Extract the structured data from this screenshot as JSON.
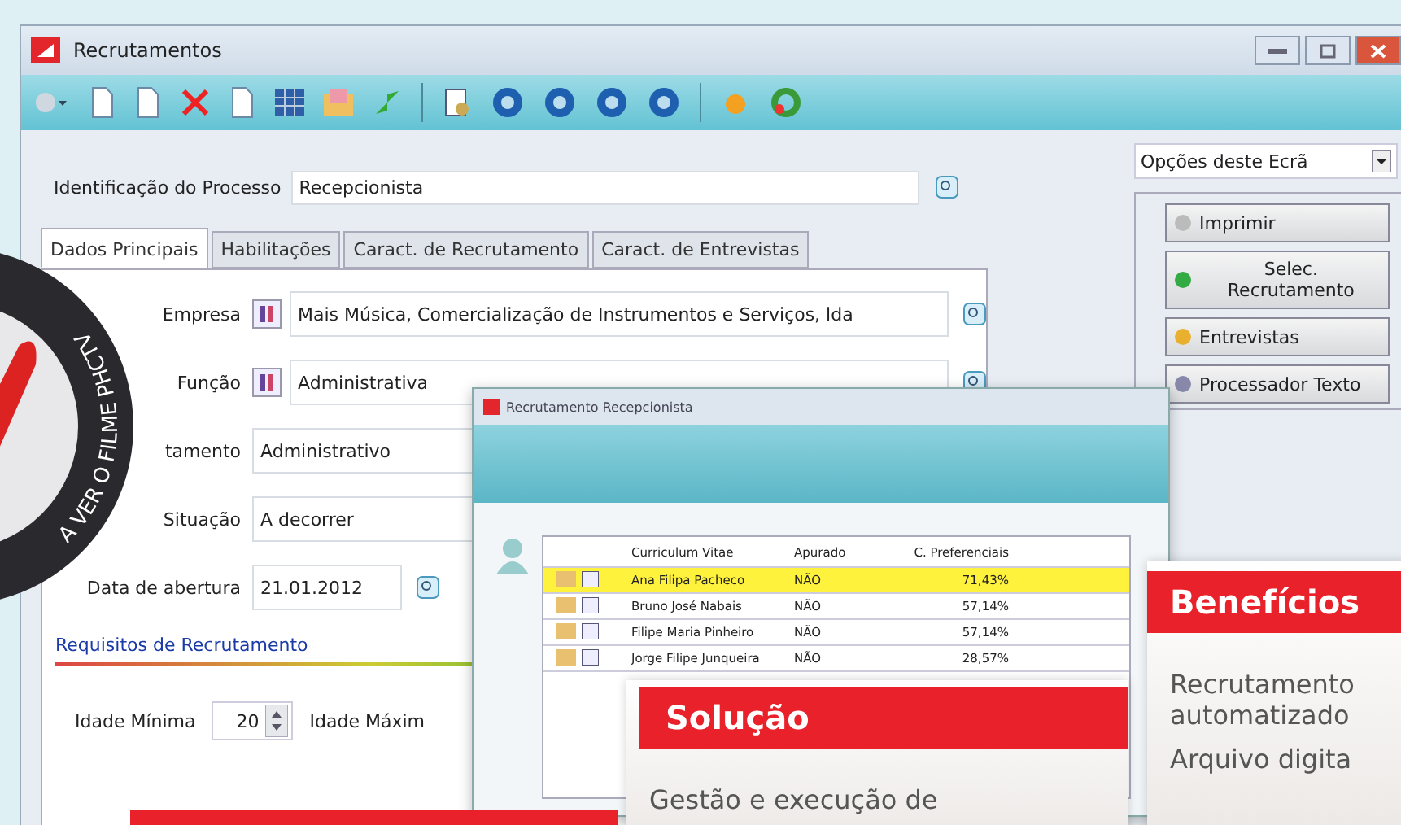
{
  "window": {
    "title": "Recrutamentos"
  },
  "process": {
    "label": "Identificação do Processo",
    "value": "Recepcionista"
  },
  "tabs": [
    {
      "label": "Dados Principais",
      "selected": true
    },
    {
      "label": "Habilitações",
      "selected": false
    },
    {
      "label": "Caract. de Recrutamento",
      "selected": false
    },
    {
      "label": "Caract. de Entrevistas",
      "selected": false
    }
  ],
  "fields": [
    {
      "label": "Empresa",
      "value": "Mais Música, Comercialização de Instrumentos e Serviços, lda",
      "kind": "lookup"
    },
    {
      "label": "Função",
      "value": "Administrativa",
      "kind": "lookup"
    },
    {
      "label": "tamento",
      "value": "Administrativo",
      "kind": "text"
    },
    {
      "label": "Situação",
      "value": "A decorrer",
      "kind": "text"
    },
    {
      "label": "Data de abertura",
      "value": "21.01.2012",
      "kind": "date"
    }
  ],
  "section_link": "Requisitos de Recrutamento",
  "age": {
    "min_label": "Idade Mínima",
    "min_value": "20",
    "max_label": "Idade Máxim"
  },
  "options": {
    "dropdown": "Opções deste Ecrã",
    "buttons": [
      "Imprimir",
      "Selec. Recrutamento",
      "Entrevistas",
      "Processador Texto"
    ]
  },
  "badge": {
    "text": "A VER O FILME PHCTV"
  },
  "popup": {
    "title": "Recrutamento Recepcionista",
    "columns": [
      "Curriculum Vitae",
      "Apurado",
      "C. Preferenciais"
    ],
    "rows": [
      {
        "name": "Ana Filipa Pacheco",
        "result": "NÃO",
        "score": "71,43%",
        "selected": true
      },
      {
        "name": "Bruno José Nabais",
        "result": "NÃO",
        "score": "57,14%",
        "selected": false
      },
      {
        "name": "Filipe Maria Pinheiro",
        "result": "NÃO",
        "score": "57,14%",
        "selected": false
      },
      {
        "name": "Jorge Filipe Junqueira",
        "result": "NÃO",
        "score": "28,57%",
        "selected": false
      }
    ]
  },
  "solution": {
    "title": "Solução",
    "text": "Gestão e execução de"
  },
  "benefits": {
    "title": "Benefícios",
    "lines": [
      "Recrutamento",
      "automatizado",
      "Arquivo digita"
    ]
  }
}
